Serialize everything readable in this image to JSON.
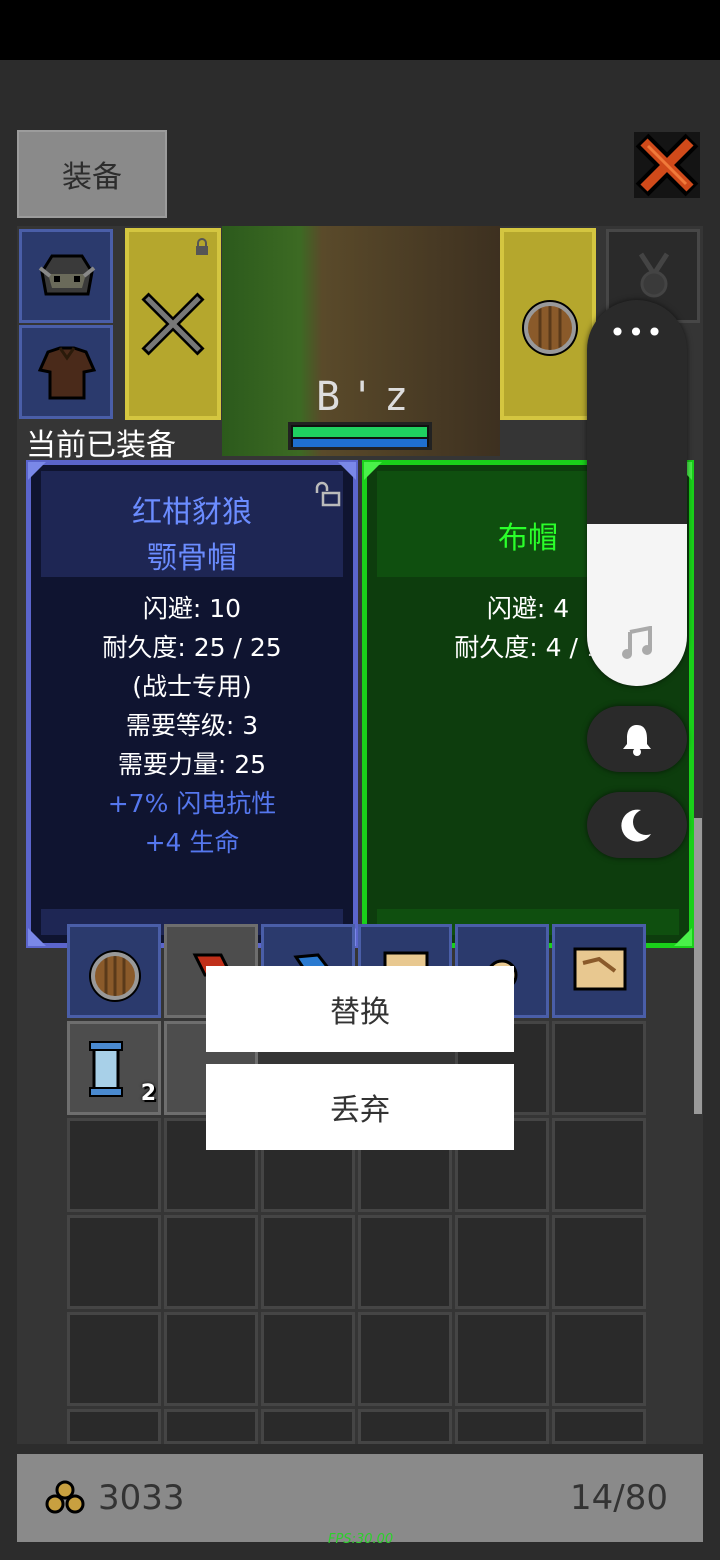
{
  "header": {
    "tab_label": "装备"
  },
  "scene": {
    "player_name": "B'z",
    "hp_fraction": 1.0
  },
  "equipped_label": "当前已装备",
  "current_item": {
    "name_line1": "红柑豺狼",
    "name_line2": "颚骨帽",
    "stats": [
      "闪避: 10",
      "耐久度: 25 / 25",
      "(战士专用)",
      "需要等级: 3",
      "需要力量: 25"
    ],
    "bonuses": [
      "+7% 闪电抗性",
      "+4 生命"
    ]
  },
  "new_item": {
    "name": "布帽",
    "stats": [
      "闪避: 4",
      "耐久度: 4 / 1"
    ]
  },
  "menu": {
    "replace_label": "替换",
    "discard_label": "丢弃"
  },
  "inventory": {
    "scroll_count": "2"
  },
  "footer": {
    "gold": "3033",
    "capacity": "14/80",
    "fps": "FPS:30.00"
  },
  "volume_panel": {
    "more_label": "•••",
    "level": 0.42
  },
  "colors": {
    "rare_blue": "#6b8cff",
    "common_green": "#2aff2a",
    "bonus_blue": "#5577ee"
  }
}
